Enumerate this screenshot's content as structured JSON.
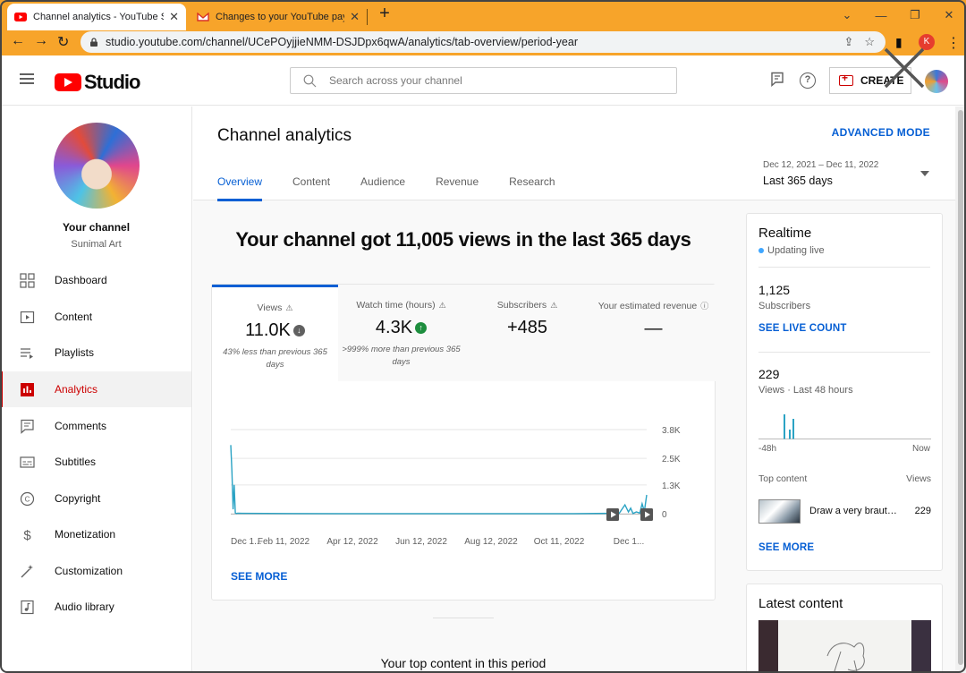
{
  "browser": {
    "tabs": [
      {
        "title": "Channel analytics - YouTube Studio",
        "active": true
      },
      {
        "title": "Changes to your YouTube payme",
        "active": false
      }
    ],
    "url": "studio.youtube.com/channel/UCePOyjjieNMM-DSJDpx6qwA/analytics/tab-overview/period-year",
    "profile_initial": "K",
    "colors": {
      "frame": "#f7a42a"
    }
  },
  "header": {
    "logo_text": "Studio",
    "search_placeholder": "Search across your channel",
    "create_label": "CREATE"
  },
  "sidebar": {
    "channel_label": "Your channel",
    "channel_name": "Sunimal Art",
    "items": [
      {
        "label": "Dashboard",
        "icon": "dashboard-icon"
      },
      {
        "label": "Content",
        "icon": "content-icon"
      },
      {
        "label": "Playlists",
        "icon": "playlists-icon"
      },
      {
        "label": "Analytics",
        "icon": "analytics-icon",
        "active": true
      },
      {
        "label": "Comments",
        "icon": "comments-icon"
      },
      {
        "label": "Subtitles",
        "icon": "subtitles-icon"
      },
      {
        "label": "Copyright",
        "icon": "copyright-icon"
      },
      {
        "label": "Monetization",
        "icon": "monetization-icon"
      },
      {
        "label": "Customization",
        "icon": "customization-icon"
      },
      {
        "label": "Audio library",
        "icon": "audio-library-icon"
      }
    ]
  },
  "main": {
    "title": "Channel analytics",
    "advanced_mode": "ADVANCED MODE",
    "tabs": [
      "Overview",
      "Content",
      "Audience",
      "Revenue",
      "Research"
    ],
    "date_range": {
      "sub": "Dec 12, 2021 – Dec 11, 2022",
      "value": "Last 365 days"
    },
    "summary": "Your channel got 11,005 views in the last 365 days",
    "metrics": [
      {
        "label": "Views",
        "value": "11.0K",
        "trend": "down",
        "note": "43% less than previous 365 days"
      },
      {
        "label": "Watch time (hours)",
        "value": "4.3K",
        "trend": "up",
        "note": ">999% more than previous 365 days"
      },
      {
        "label": "Subscribers",
        "value": "+485",
        "note": ""
      },
      {
        "label": "Your estimated revenue",
        "value": "—",
        "note": ""
      }
    ],
    "see_more": "SEE MORE",
    "top_content_title": "Your top content in this period"
  },
  "chart_data": {
    "type": "line",
    "title": "",
    "xlabel": "",
    "ylabel": "",
    "x_ticks": [
      "Dec 1...",
      "Feb 11, 2022",
      "Apr 12, 2022",
      "Jun 12, 2022",
      "Aug 12, 2022",
      "Oct 11, 2022",
      "Dec 1..."
    ],
    "y_ticks": [
      "0",
      "1.3K",
      "2.5K",
      "3.8K"
    ],
    "ylim": [
      0,
      3800
    ],
    "series": [
      {
        "name": "",
        "color": "#2ba3c4",
        "x": [
          0,
          1,
          2,
          3,
          4,
          5,
          6,
          10,
          50,
          100,
          150,
          200,
          250,
          300,
          340,
          345,
          348,
          350,
          352,
          355,
          358,
          360,
          362,
          364
        ],
        "y": [
          3100,
          1900,
          200,
          1300,
          30,
          10,
          20,
          15,
          10,
          5,
          5,
          5,
          5,
          5,
          20,
          400,
          80,
          250,
          10,
          80,
          30,
          450,
          100,
          850
        ]
      }
    ]
  },
  "realtime": {
    "title": "Realtime",
    "live": "Updating live",
    "subscribers_value": "1,125",
    "subscribers_label": "Subscribers",
    "see_live_count": "SEE LIVE COUNT",
    "views_value": "229",
    "views_label": "Views · Last 48 hours",
    "axis_left": "-48h",
    "axis_right": "Now",
    "top_content_label": "Top content",
    "views_col": "Views",
    "top_item_title": "Draw a very brautiful",
    "top_item_views": "229",
    "see_more": "SEE MORE",
    "spark_values": [
      0,
      0,
      0,
      0,
      0,
      0,
      0,
      0,
      0,
      0,
      0,
      0,
      0,
      0,
      0,
      0,
      0,
      0,
      0,
      0,
      0,
      0,
      0,
      0,
      0,
      0,
      0,
      0,
      0,
      0,
      0,
      0,
      0,
      0,
      0,
      0,
      0,
      0,
      0,
      0,
      0,
      0,
      0,
      0,
      0,
      0,
      0,
      0,
      0,
      0,
      0,
      0,
      0,
      0,
      0,
      0,
      0,
      0,
      0,
      0,
      0,
      0,
      0,
      0,
      0,
      0,
      0,
      0,
      0,
      0,
      0,
      0,
      0,
      0,
      0,
      0,
      0,
      0,
      0,
      0,
      0,
      0,
      0,
      0,
      0,
      0,
      0,
      0,
      0,
      0,
      0,
      0,
      0,
      0,
      0,
      0,
      0,
      0,
      0,
      0,
      0,
      0,
      0,
      0,
      0,
      0,
      0,
      0,
      0,
      0,
      0,
      0,
      0,
      0,
      0,
      0,
      0,
      0,
      0,
      0,
      0,
      0,
      0,
      0,
      0,
      0,
      0,
      0,
      0,
      0,
      0,
      0,
      0,
      0,
      0,
      0,
      0,
      0,
      0,
      0,
      0,
      0,
      0,
      0,
      0,
      0,
      0,
      0,
      0,
      0,
      0,
      0,
      0,
      0,
      0,
      0,
      0,
      0,
      0,
      0,
      0,
      0,
      0,
      0,
      0,
      0,
      0,
      0,
      0,
      0,
      0,
      0,
      0,
      0,
      0,
      0,
      0,
      0,
      0,
      0,
      0,
      0,
      0,
      0,
      0,
      0,
      0,
      0,
      0,
      0,
      0,
      0,
      0
    ]
  },
  "latest": {
    "title": "Latest content"
  }
}
